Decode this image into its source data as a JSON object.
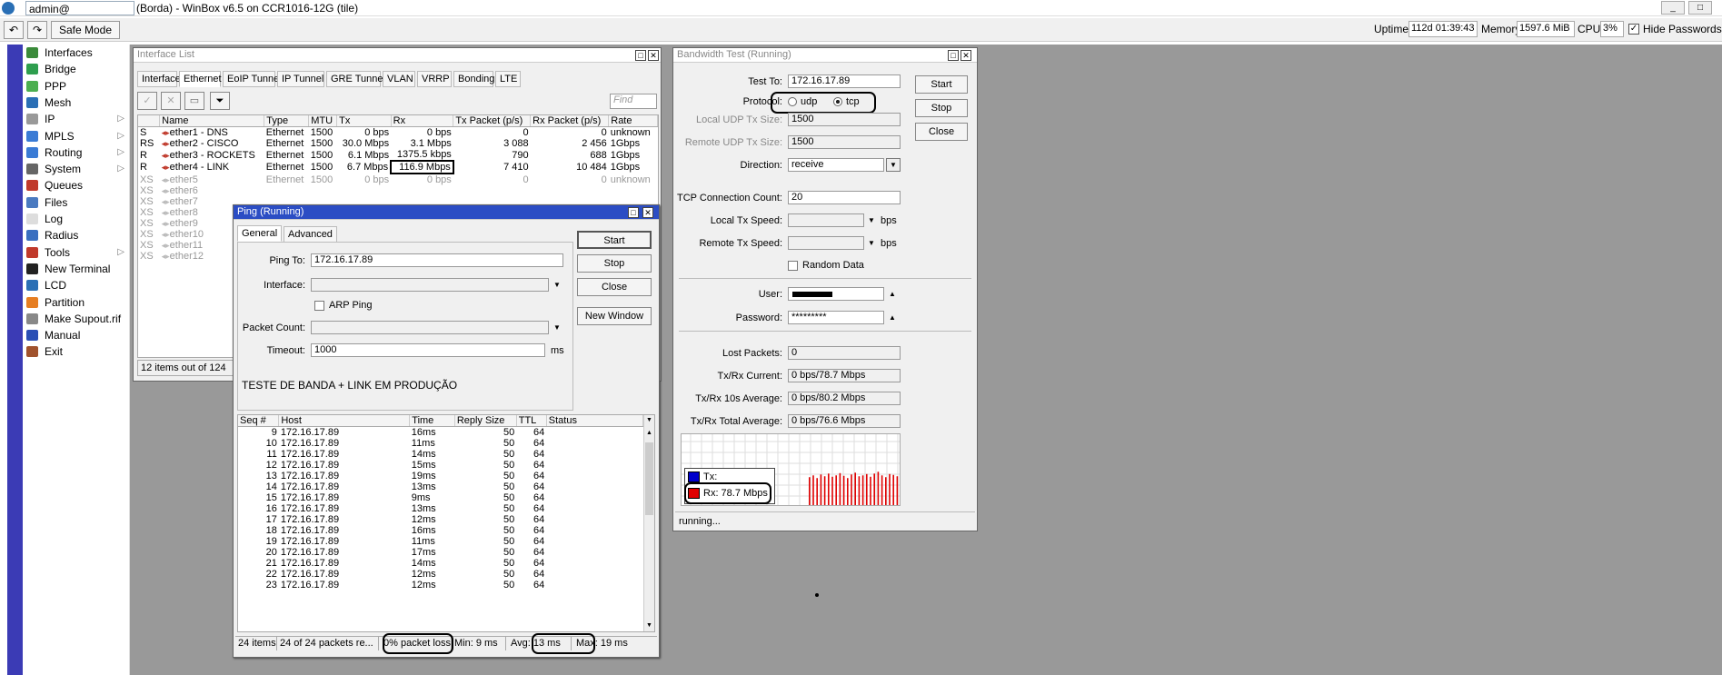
{
  "titlebar": {
    "user": "admin@",
    "title": "(Borda) - WinBox v6.5 on CCR1016-12G (tile)"
  },
  "toolbar": {
    "safe_mode": "Safe Mode",
    "uptime_label": "Uptime:",
    "uptime": "112d 01:39:43",
    "memory_label": "Memory:",
    "memory": "1597.6 MiB",
    "cpu_label": "CPU:",
    "cpu": "3%",
    "hide_passwords": "Hide Passwords"
  },
  "menu": [
    {
      "label": "Interfaces",
      "icon": "interfaces-icon",
      "color": "#3a8a3a"
    },
    {
      "label": "Bridge",
      "icon": "bridge-icon",
      "color": "#2e9e4e"
    },
    {
      "label": "PPP",
      "icon": "ppp-icon",
      "color": "#4caf50"
    },
    {
      "label": "Mesh",
      "icon": "mesh-icon",
      "color": "#2a6fb5"
    },
    {
      "label": "IP",
      "icon": "ip-icon",
      "color": "#999",
      "arrow": true
    },
    {
      "label": "MPLS",
      "icon": "mpls-icon",
      "color": "#3a7bd5",
      "arrow": true
    },
    {
      "label": "Routing",
      "icon": "routing-icon",
      "color": "#3a7bd5",
      "arrow": true
    },
    {
      "label": "System",
      "icon": "system-icon",
      "color": "#666",
      "arrow": true
    },
    {
      "label": "Queues",
      "icon": "queues-icon",
      "color": "#c0392b"
    },
    {
      "label": "Files",
      "icon": "files-icon",
      "color": "#4a7ac0"
    },
    {
      "label": "Log",
      "icon": "log-icon",
      "color": "#ddd"
    },
    {
      "label": "Radius",
      "icon": "radius-icon",
      "color": "#3a6fc0"
    },
    {
      "label": "Tools",
      "icon": "tools-icon",
      "color": "#c0392b",
      "arrow": true
    },
    {
      "label": "New Terminal",
      "icon": "terminal-icon",
      "color": "#222"
    },
    {
      "label": "LCD",
      "icon": "lcd-icon",
      "color": "#2a6fb5"
    },
    {
      "label": "Partition",
      "icon": "partition-icon",
      "color": "#e67e22"
    },
    {
      "label": "Make Supout.rif",
      "icon": "supout-icon",
      "color": "#888"
    },
    {
      "label": "Manual",
      "icon": "manual-icon",
      "color": "#2a4fb5"
    },
    {
      "label": "Exit",
      "icon": "exit-icon",
      "color": "#a0522d"
    }
  ],
  "iflist": {
    "title": "Interface List",
    "tabs": [
      "Interface",
      "Ethernet",
      "EoIP Tunnel",
      "IP Tunnel",
      "GRE Tunnel",
      "VLAN",
      "VRRP",
      "Bonding",
      "LTE"
    ],
    "find_placeholder": "Find",
    "columns": [
      "Name",
      "Type",
      "MTU",
      "Tx",
      "Rx",
      "Tx Packet (p/s)",
      "Rx Packet (p/s)",
      "Rate"
    ],
    "rows": [
      {
        "flag": "S",
        "name": "ether1 - DNS",
        "type": "Ethernet",
        "mtu": "1500",
        "tx": "0 bps",
        "rx": "0 bps",
        "txp": "0",
        "rxp": "0",
        "rate": "unknown"
      },
      {
        "flag": "RS",
        "name": "ether2 - CISCO",
        "type": "Ethernet",
        "mtu": "1500",
        "tx": "30.0 Mbps",
        "rx": "3.1 Mbps",
        "txp": "3 088",
        "rxp": "2 456",
        "rate": "1Gbps"
      },
      {
        "flag": "R",
        "name": "ether3 - ROCKETS",
        "type": "Ethernet",
        "mtu": "1500",
        "tx": "6.1 Mbps",
        "rx": "1375.5 kbps",
        "txp": "790",
        "rxp": "688",
        "rate": "1Gbps"
      },
      {
        "flag": "R",
        "name": "ether4 - LINK",
        "type": "Ethernet",
        "mtu": "1500",
        "tx": "6.7 Mbps",
        "rx": "116.9 Mbps",
        "txp": "7 410",
        "rxp": "10 484",
        "rate": "1Gbps"
      },
      {
        "flag": "XS",
        "name": "ether5",
        "type": "Ethernet",
        "mtu": "1500",
        "tx": "0 bps",
        "rx": "0 bps",
        "txp": "0",
        "rxp": "0",
        "rate": "unknown"
      },
      {
        "flag": "XS",
        "name": "ether6"
      },
      {
        "flag": "XS",
        "name": "ether7"
      },
      {
        "flag": "XS",
        "name": "ether8"
      },
      {
        "flag": "XS",
        "name": "ether9"
      },
      {
        "flag": "XS",
        "name": "ether10"
      },
      {
        "flag": "XS",
        "name": "ether11"
      },
      {
        "flag": "XS",
        "name": "ether12"
      }
    ],
    "status": "12 items out of 124"
  },
  "ping": {
    "title": "Ping (Running)",
    "tabs": [
      "General",
      "Advanced"
    ],
    "ping_to_label": "Ping To:",
    "ping_to": "172.16.17.89",
    "interface_label": "Interface:",
    "arp_label": "ARP Ping",
    "packet_count_label": "Packet Count:",
    "timeout_label": "Timeout:",
    "timeout": "1000",
    "timeout_unit": "ms",
    "note": "TESTE DE BANDA + LINK EM PRODUÇÃO",
    "buttons": [
      "Start",
      "Stop",
      "Close",
      "New Window"
    ],
    "columns": [
      "Seq #",
      "Host",
      "Time",
      "Reply Size",
      "TTL",
      "Status"
    ],
    "rows": [
      {
        "seq": "9",
        "host": "172.16.17.89",
        "time": "16ms",
        "size": "50",
        "ttl": "64"
      },
      {
        "seq": "10",
        "host": "172.16.17.89",
        "time": "11ms",
        "size": "50",
        "ttl": "64"
      },
      {
        "seq": "11",
        "host": "172.16.17.89",
        "time": "14ms",
        "size": "50",
        "ttl": "64"
      },
      {
        "seq": "12",
        "host": "172.16.17.89",
        "time": "15ms",
        "size": "50",
        "ttl": "64"
      },
      {
        "seq": "13",
        "host": "172.16.17.89",
        "time": "19ms",
        "size": "50",
        "ttl": "64"
      },
      {
        "seq": "14",
        "host": "172.16.17.89",
        "time": "13ms",
        "size": "50",
        "ttl": "64"
      },
      {
        "seq": "15",
        "host": "172.16.17.89",
        "time": "9ms",
        "size": "50",
        "ttl": "64"
      },
      {
        "seq": "16",
        "host": "172.16.17.89",
        "time": "13ms",
        "size": "50",
        "ttl": "64"
      },
      {
        "seq": "17",
        "host": "172.16.17.89",
        "time": "12ms",
        "size": "50",
        "ttl": "64"
      },
      {
        "seq": "18",
        "host": "172.16.17.89",
        "time": "16ms",
        "size": "50",
        "ttl": "64"
      },
      {
        "seq": "19",
        "host": "172.16.17.89",
        "time": "11ms",
        "size": "50",
        "ttl": "64"
      },
      {
        "seq": "20",
        "host": "172.16.17.89",
        "time": "17ms",
        "size": "50",
        "ttl": "64"
      },
      {
        "seq": "21",
        "host": "172.16.17.89",
        "time": "14ms",
        "size": "50",
        "ttl": "64"
      },
      {
        "seq": "22",
        "host": "172.16.17.89",
        "time": "12ms",
        "size": "50",
        "ttl": "64"
      },
      {
        "seq": "23",
        "host": "172.16.17.89",
        "time": "12ms",
        "size": "50",
        "ttl": "64"
      }
    ],
    "status": {
      "items": "24 items",
      "packets": "24 of 24 packets re...",
      "loss": "0% packet loss",
      "min": "Min: 9 ms",
      "avg": "Avg: 13 ms",
      "max": "Max: 19 ms"
    }
  },
  "bw": {
    "title": "Bandwidth Test (Running)",
    "test_to_label": "Test To:",
    "test_to": "172.16.17.89",
    "protocol_label": "Protocol:",
    "udp": "udp",
    "tcp": "tcp",
    "local_udp_label": "Local UDP Tx Size:",
    "local_udp": "1500",
    "remote_udp_label": "Remote UDP Tx Size:",
    "remote_udp": "1500",
    "direction_label": "Direction:",
    "direction": "receive",
    "tcp_count_label": "TCP Connection Count:",
    "tcp_count": "20",
    "local_speed_label": "Local Tx Speed:",
    "remote_speed_label": "Remote Tx Speed:",
    "bps": "bps",
    "random_label": "Random Data",
    "user_label": "User:",
    "password_label": "Password:",
    "password": "*********",
    "lost_label": "Lost Packets:",
    "lost": "0",
    "current_label": "Tx/Rx Current:",
    "current": "0 bps/78.7 Mbps",
    "avg10_label": "Tx/Rx 10s Average:",
    "avg10": "0 bps/80.2 Mbps",
    "total_label": "Tx/Rx Total Average:",
    "total": "0 bps/76.6 Mbps",
    "buttons": [
      "Start",
      "Stop",
      "Close"
    ],
    "legend_tx": "Tx:",
    "legend_rx": "Rx:  78.7 Mbps",
    "tx_color": "#0000cc",
    "rx_color": "#e00000",
    "status": "running..."
  },
  "chart_data": {
    "type": "bar",
    "series": [
      {
        "name": "Rx",
        "values": [
          0.62,
          0.66,
          0.6,
          0.68,
          0.64,
          0.7,
          0.63,
          0.66,
          0.71,
          0.65,
          0.6,
          0.68,
          0.72,
          0.64,
          0.66,
          0.69,
          0.63,
          0.7,
          0.74,
          0.66,
          0.62,
          0.69,
          0.67,
          0.64
        ]
      }
    ]
  }
}
